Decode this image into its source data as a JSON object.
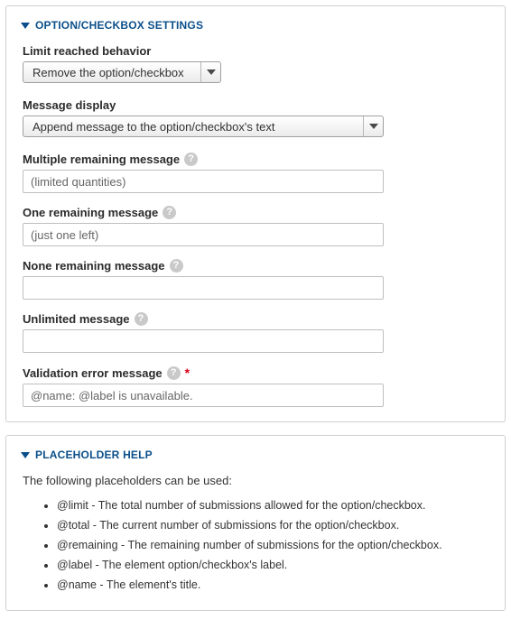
{
  "section_options": {
    "title": "OPTION/CHECKBOX SETTINGS",
    "fields": {
      "limit_behavior": {
        "label": "Limit reached behavior",
        "value": "Remove the option/checkbox"
      },
      "message_display": {
        "label": "Message display",
        "value": "Append message to the option/checkbox's text"
      },
      "multiple_remaining": {
        "label": "Multiple remaining message",
        "value": "(limited quantities)"
      },
      "one_remaining": {
        "label": "One remaining message",
        "value": "(just one left)"
      },
      "none_remaining": {
        "label": "None remaining message",
        "value": ""
      },
      "unlimited": {
        "label": "Unlimited message",
        "value": ""
      },
      "validation_error": {
        "label": "Validation error message",
        "value": "@name: @label is unavailable."
      }
    }
  },
  "section_placeholder": {
    "title": "PLACEHOLDER HELP",
    "intro": "The following placeholders can be used:",
    "items": [
      "@limit - The total number of submissions allowed for the option/checkbox.",
      "@total - The current number of submissions for the option/checkbox.",
      "@remaining - The remaining number of submissions for the option/checkbox.",
      "@label - The element option/checkbox's label.",
      "@name - The element's title."
    ]
  },
  "icons": {
    "help": "?",
    "required": "*"
  }
}
